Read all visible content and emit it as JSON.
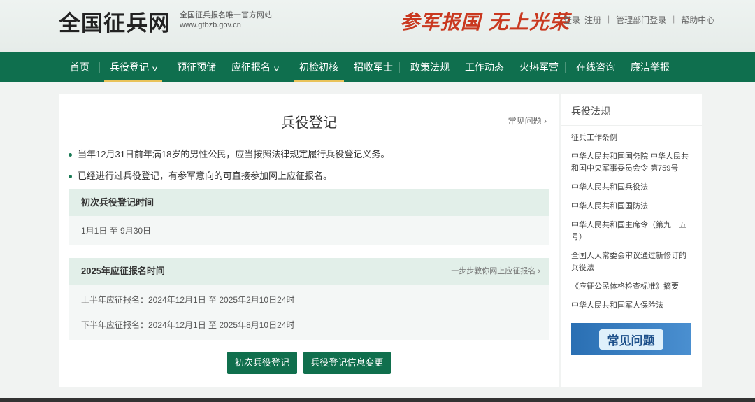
{
  "header": {
    "logo": "全国征兵网",
    "tagline": "全国征兵报名唯一官方网站",
    "url": "www.gfbzb.gov.cn",
    "slogan": "参军报国 无上光荣",
    "links": [
      "登录",
      "注册",
      "管理部门登录",
      "帮助中心"
    ]
  },
  "nav": [
    {
      "label": "首页"
    },
    {
      "label": "兵役登记"
    },
    {
      "label": "预征预储"
    },
    {
      "label": "应征报名"
    },
    {
      "label": "初检初核"
    },
    {
      "label": "招收军士"
    },
    {
      "label": "政策法规"
    },
    {
      "label": "工作动态"
    },
    {
      "label": "火热军营"
    },
    {
      "label": "在线咨询"
    },
    {
      "label": "廉洁举报"
    }
  ],
  "main": {
    "title": "兵役登记",
    "faq_link": "常见问题",
    "bullets": [
      "当年12月31日前年满18岁的男性公民，应当按照法律规定履行兵役登记义务。",
      "已经进行过兵役登记，有参军意向的可直接参加网上应征报名。"
    ],
    "first_reg": {
      "heading": "初次兵役登记时间",
      "period": "1月1日 至 9月30日"
    },
    "enlist": {
      "heading": "2025年应征报名时间",
      "guide_link": "一步步教你网上应征报名",
      "rows": [
        "上半年应征报名：2024年12月1日 至 2025年2月10日24时",
        "下半年应征报名：2024年12月1日 至 2025年8月10日24时"
      ]
    },
    "buttons": {
      "first": "初次兵役登记",
      "change": "兵役登记信息变更"
    }
  },
  "sidebar": {
    "title": "兵役法规",
    "items": [
      "征兵工作条例",
      "中华人民共和国国务院 中华人民共和国中央军事委员会令 第759号",
      "中华人民共和国兵役法",
      "中华人民共和国国防法",
      "中华人民共和国主席令（第九十五号）",
      "全国人大常委会审议通过新修订的兵役法",
      "《应征公民体格检查标准》摘要",
      "中华人民共和国军人保险法"
    ],
    "banner": "常见问题"
  },
  "colors": {
    "primary": "#0f6f4e",
    "accent": "#e9c35a",
    "slogan": "#c9381f"
  }
}
